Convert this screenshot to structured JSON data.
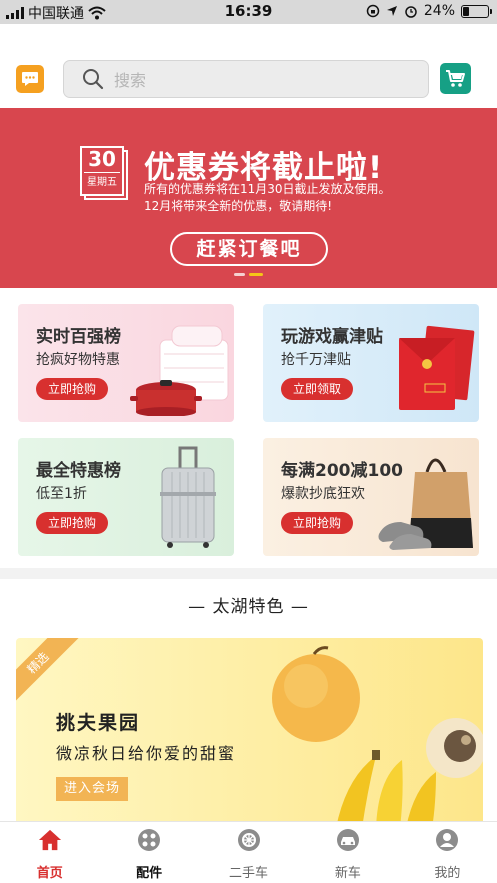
{
  "status_bar": {
    "carrier": "中国联通",
    "time": "16:39",
    "battery": "24%",
    "battery_level": 0.24
  },
  "header": {
    "search_placeholder": "搜索",
    "message_icon": "chat-bubble-icon",
    "cart_icon": "shopping-cart-icon"
  },
  "banner": {
    "calendar_day": "30",
    "calendar_weekday": "星期五",
    "title": "优惠券将截止啦!",
    "line1": "所有的优惠券将在11月30日截止发放及使用。",
    "line2": "12月将带来全新的优惠，敬请期待!",
    "button": "赶紧订餐吧",
    "background_color": "#d8464e"
  },
  "promos": [
    {
      "title": "实时百强榜",
      "subtitle": "抢疯好物特惠",
      "button": "立即抢购"
    },
    {
      "title": "玩游戏赢津贴",
      "subtitle": "抢千万津贴",
      "button": "立即领取"
    },
    {
      "title": "最全特惠榜",
      "subtitle": "低至1折",
      "button": "立即抢购"
    },
    {
      "title": "每满200减100",
      "subtitle": "爆款抄底狂欢",
      "button": "立即抢购"
    }
  ],
  "section": {
    "title": "— 太湖特色 —"
  },
  "feature": {
    "ribbon": "精选",
    "title": "挑夫果园",
    "subtitle": "微凉秋日给你爱的甜蜜",
    "button": "进入会场"
  },
  "tabbar": {
    "items": [
      {
        "label": "首页",
        "icon": "home-icon",
        "active": true
      },
      {
        "label": "配件",
        "icon": "parts-icon"
      },
      {
        "label": "二手车",
        "icon": "wheel-icon"
      },
      {
        "label": "新车",
        "icon": "car-icon"
      },
      {
        "label": "我的",
        "icon": "user-icon"
      }
    ],
    "active_color": "#d8302f"
  }
}
